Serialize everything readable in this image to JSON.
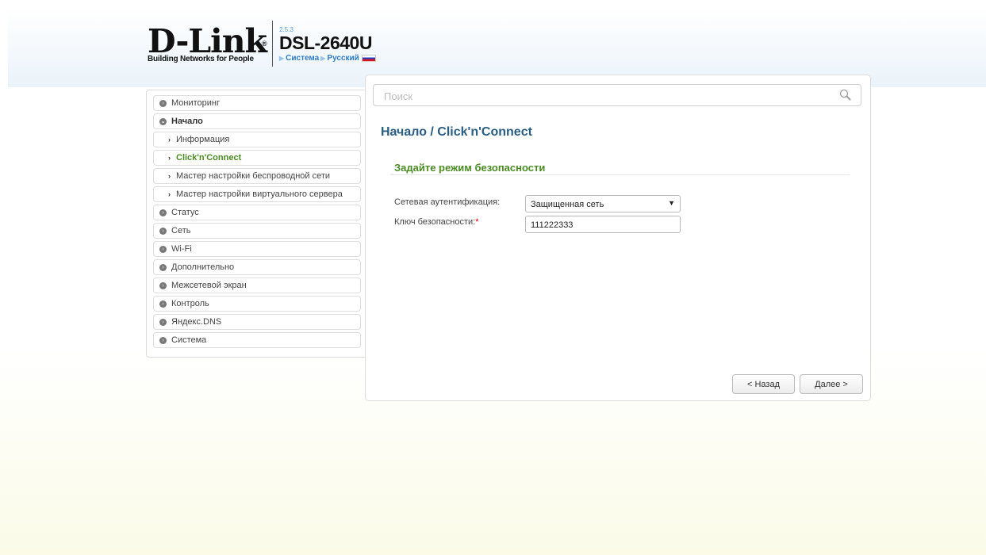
{
  "header": {
    "logo_text": "D-Link",
    "logo_registered": "®",
    "logo_tagline": "Building Networks for People",
    "firmware_version": "2.5.3",
    "model": "DSL-2640U",
    "nav_system": "Система",
    "nav_language": "Русский"
  },
  "sidebar": {
    "items": [
      {
        "label": "Мониторинг"
      },
      {
        "label": "Начало"
      },
      {
        "label": "Информация"
      },
      {
        "label": "Click'n'Connect"
      },
      {
        "label": "Мастер настройки беспроводной сети"
      },
      {
        "label": "Мастер настройки виртуального сервера"
      },
      {
        "label": "Статус"
      },
      {
        "label": "Сеть"
      },
      {
        "label": "Wi-Fi"
      },
      {
        "label": "Дополнительно"
      },
      {
        "label": "Межсетевой экран"
      },
      {
        "label": "Контроль"
      },
      {
        "label": "Яндекс.DNS"
      },
      {
        "label": "Система"
      }
    ]
  },
  "search": {
    "placeholder": "Поиск"
  },
  "main": {
    "title": "Начало /  Click'n'Connect",
    "section_title": "Задайте режим безопасности",
    "auth_label": "Сетевая аутентификация:",
    "auth_value": "Защищенная сеть",
    "key_label": "Ключ безопасности:",
    "key_required": "*",
    "key_value": "111222333"
  },
  "buttons": {
    "back": "< Назад",
    "next": "Далее >"
  },
  "colors": {
    "accent_green": "#4a8a22",
    "title_blue": "#2a5d82",
    "link_blue": "#2f7bbf"
  }
}
